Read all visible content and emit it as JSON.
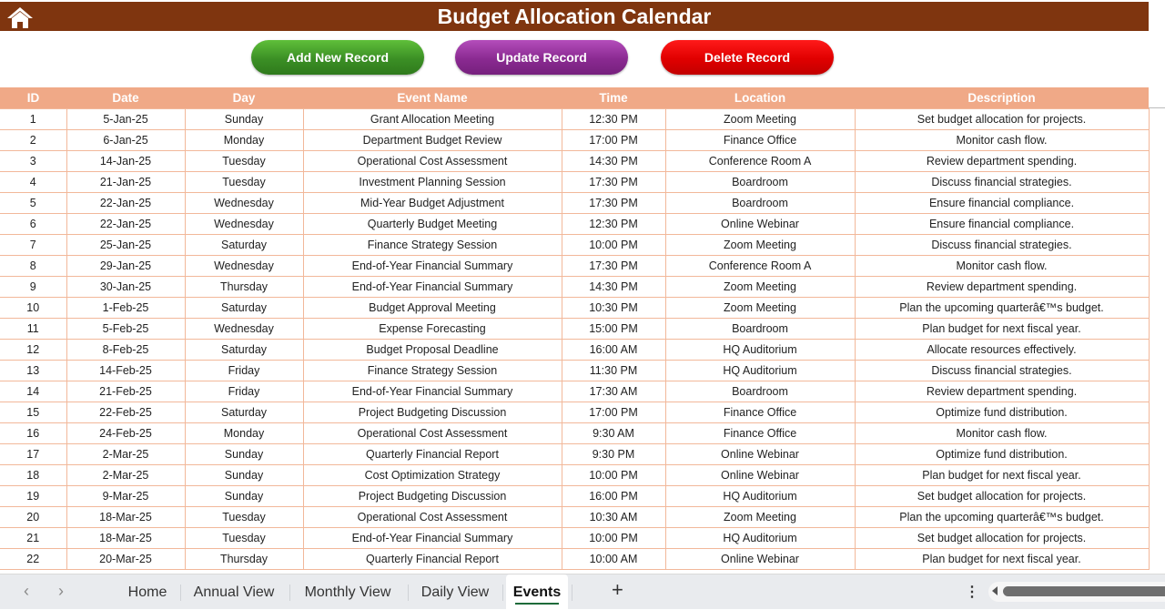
{
  "header": {
    "title": "Budget Allocation Calendar",
    "home_icon": "home-icon",
    "bar_color": "#7f350f"
  },
  "buttons": {
    "add": "Add New Record",
    "update": "Update Record",
    "delete": "Delete Record",
    "colors": {
      "add": "#3b8f25",
      "update": "#8a2a91",
      "delete": "#e00000"
    }
  },
  "table": {
    "header_color": "#f0a987",
    "columns": [
      "ID",
      "Date",
      "Day",
      "Event Name",
      "Time",
      "Location",
      "Description"
    ],
    "rows": [
      [
        "1",
        "5-Jan-25",
        "Sunday",
        "Grant Allocation Meeting",
        "12:30 PM",
        "Zoom Meeting",
        "Set budget allocation for projects."
      ],
      [
        "2",
        "6-Jan-25",
        "Monday",
        "Department Budget Review",
        "17:00 PM",
        "Finance Office",
        "Monitor cash flow."
      ],
      [
        "3",
        "14-Jan-25",
        "Tuesday",
        "Operational Cost Assessment",
        "14:30 PM",
        "Conference Room A",
        "Review department spending."
      ],
      [
        "4",
        "21-Jan-25",
        "Tuesday",
        "Investment Planning Session",
        "17:30 PM",
        "Boardroom",
        "Discuss financial strategies."
      ],
      [
        "5",
        "22-Jan-25",
        "Wednesday",
        "Mid-Year Budget Adjustment",
        "17:30 PM",
        "Boardroom",
        "Ensure financial compliance."
      ],
      [
        "6",
        "22-Jan-25",
        "Wednesday",
        "Quarterly Budget Meeting",
        "12:30 PM",
        "Online Webinar",
        "Ensure financial compliance."
      ],
      [
        "7",
        "25-Jan-25",
        "Saturday",
        "Finance Strategy Session",
        "10:00 PM",
        "Zoom Meeting",
        "Discuss financial strategies."
      ],
      [
        "8",
        "29-Jan-25",
        "Wednesday",
        "End-of-Year Financial Summary",
        "17:30 PM",
        "Conference Room A",
        "Monitor cash flow."
      ],
      [
        "9",
        "30-Jan-25",
        "Thursday",
        "End-of-Year Financial Summary",
        "14:30 PM",
        "Zoom Meeting",
        "Review department spending."
      ],
      [
        "10",
        "1-Feb-25",
        "Saturday",
        "Budget Approval Meeting",
        "10:30 PM",
        "Zoom Meeting",
        "Plan the upcoming quarterâ€™s budget."
      ],
      [
        "11",
        "5-Feb-25",
        "Wednesday",
        "Expense Forecasting",
        "15:00 PM",
        "Boardroom",
        "Plan budget for next fiscal year."
      ],
      [
        "12",
        "8-Feb-25",
        "Saturday",
        "Budget Proposal Deadline",
        "16:00 AM",
        "HQ Auditorium",
        "Allocate resources effectively."
      ],
      [
        "13",
        "14-Feb-25",
        "Friday",
        "Finance Strategy Session",
        "11:30 PM",
        "HQ Auditorium",
        "Discuss financial strategies."
      ],
      [
        "14",
        "21-Feb-25",
        "Friday",
        "End-of-Year Financial Summary",
        "17:30 AM",
        "Boardroom",
        "Review department spending."
      ],
      [
        "15",
        "22-Feb-25",
        "Saturday",
        "Project Budgeting Discussion",
        "17:00 PM",
        "Finance Office",
        "Optimize fund distribution."
      ],
      [
        "16",
        "24-Feb-25",
        "Monday",
        "Operational Cost Assessment",
        "9:30 AM",
        "Finance Office",
        "Monitor cash flow."
      ],
      [
        "17",
        "2-Mar-25",
        "Sunday",
        "Quarterly Financial Report",
        "9:30 PM",
        "Online Webinar",
        "Optimize fund distribution."
      ],
      [
        "18",
        "2-Mar-25",
        "Sunday",
        "Cost Optimization Strategy",
        "10:00 PM",
        "Online Webinar",
        "Plan budget for next fiscal year."
      ],
      [
        "19",
        "9-Mar-25",
        "Sunday",
        "Project Budgeting Discussion",
        "16:00 PM",
        "HQ Auditorium",
        "Set budget allocation for projects."
      ],
      [
        "20",
        "18-Mar-25",
        "Tuesday",
        "Operational Cost Assessment",
        "10:30 AM",
        "Zoom Meeting",
        "Plan the upcoming quarterâ€™s budget."
      ],
      [
        "21",
        "18-Mar-25",
        "Tuesday",
        "End-of-Year Financial Summary",
        "10:00 PM",
        "HQ Auditorium",
        "Set budget allocation for projects."
      ],
      [
        "22",
        "20-Mar-25",
        "Thursday",
        "Quarterly Financial Report",
        "10:00 AM",
        "Online Webinar",
        "Plan budget for next fiscal year."
      ]
    ]
  },
  "sheet_tabs": {
    "tabs": [
      "Home",
      "Annual View",
      "Monthly View",
      "Daily View",
      "Events"
    ],
    "active": "Events",
    "prev_icon": "chevron-left-icon",
    "next_icon": "chevron-right-icon",
    "add_icon": "plus-icon",
    "more_icon": "more-vertical-icon"
  }
}
